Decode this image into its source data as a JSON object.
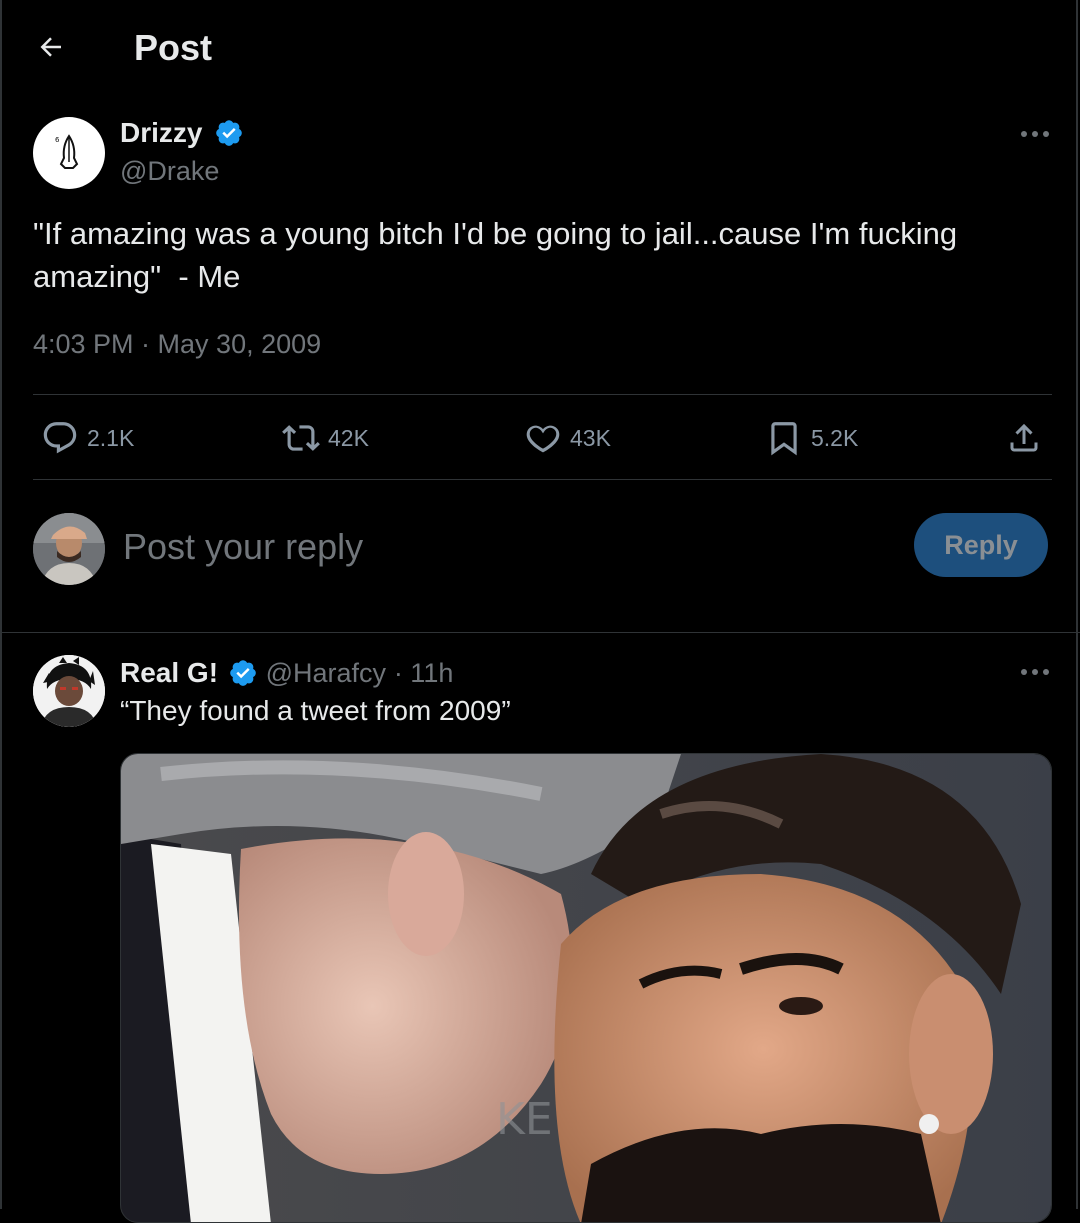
{
  "header": {
    "title": "Post"
  },
  "post": {
    "author_name": "Drizzy",
    "author_handle": "@Drake",
    "text_line1": "\"If amazing was a young bitch I'd be going to jail...cause I'm fucking",
    "text_line2": "amazing\"  - Me",
    "timestamp": "4:03 PM · May 30, 2009",
    "stats": {
      "replies": "2.1K",
      "reposts": "42K",
      "likes": "43K",
      "bookmarks": "5.2K"
    }
  },
  "compose": {
    "placeholder": "Post your reply",
    "button_label": "Reply"
  },
  "reply": {
    "author_name": "Real G!",
    "author_handle": "@Harafcy",
    "time": "· 11h",
    "text": "“They found a tweet from 2009”"
  },
  "colors": {
    "background": "#000000",
    "verified": "#1d9bf0",
    "reply_button": "#1d4f7d",
    "muted_text": "#71767b"
  },
  "icons": [
    "back-arrow-icon",
    "verified-badge-icon",
    "more-icon",
    "reply-icon",
    "repost-icon",
    "like-icon",
    "bookmark-icon",
    "share-icon"
  ]
}
